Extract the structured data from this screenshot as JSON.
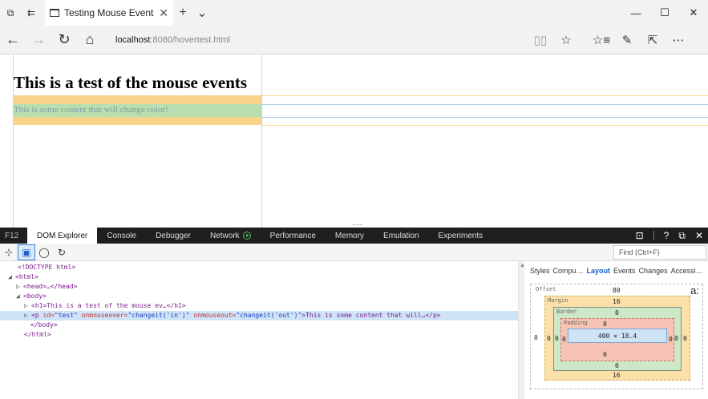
{
  "browser": {
    "tab_title": "Testing Mouse Events",
    "url_host": "localhost",
    "url_path": ":8080/hovertest.html"
  },
  "page": {
    "heading": "This is a test of the mouse events",
    "paragraph": "This is some content that will change color!"
  },
  "devtools": {
    "f12_label": "F12",
    "tabs": [
      "DOM Explorer",
      "Console",
      "Debugger",
      "Network",
      "Performance",
      "Memory",
      "Emulation",
      "Experiments"
    ],
    "find_placeholder": "Find (Ctrl+F)",
    "dom_lines": {
      "doctype": "<!DOCTYPE html>",
      "html_open": "<html>",
      "head": "<head>…</head>",
      "body_open": "<body>",
      "h1": "<h1>This is a test of the mouse ev…</h1>",
      "p_open": "<p",
      "p_id_attr": "id=",
      "p_id_val": "\"test\"",
      "p_over_attr": "onmouseover=",
      "p_over_val": "\"changeit('in')\"",
      "p_out_attr": "onmouseout=",
      "p_out_val": "\"changeit('out')\"",
      "p_rest": ">This is some content that will…</p>",
      "body_close": "</body>",
      "html_close": "</html>"
    },
    "side_tabs": [
      "Styles",
      "Compu…",
      "Layout",
      "Events",
      "Changes",
      "Accessi…"
    ],
    "box_model": {
      "offset_label": "Offset",
      "margin_label": "Margin",
      "border_label": "Border",
      "padding_label": "Padding",
      "offset_top": "80",
      "margin_top": "16",
      "border_top": "0",
      "padding_top": "0",
      "content_size": "400 × 18.4",
      "padding_bottom": "0",
      "border_bottom": "0",
      "margin_bottom": "16",
      "left_values": [
        "0",
        "0",
        "0",
        "0"
      ],
      "right_values": [
        "0",
        "0",
        "0"
      ],
      "corner_label": "a:"
    }
  }
}
